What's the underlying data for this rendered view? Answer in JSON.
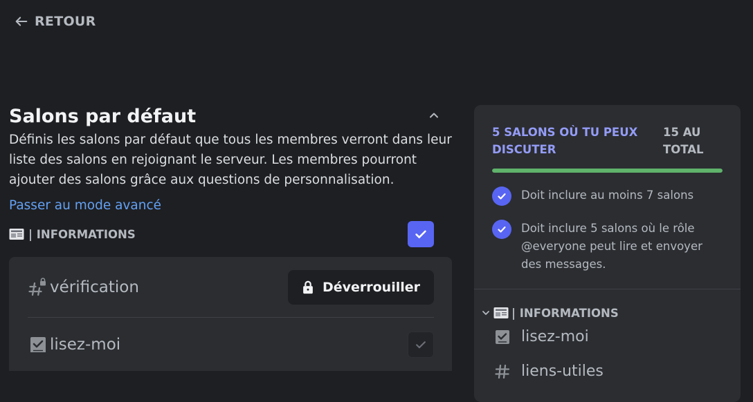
{
  "nav": {
    "back_label": "RETOUR"
  },
  "section": {
    "title": "Salons par défaut",
    "description": "Définis les salons par défaut que tous les membres verront dans leur liste des salons en rejoignant le serveur. Les membres pourront ajouter des salons grâce aux questions de personnalisation.",
    "advanced_link": "Passer au mode avancé"
  },
  "category": {
    "name": "| INFORMATIONS",
    "emoji_icon": "newspaper-icon",
    "checked": true
  },
  "channels": [
    {
      "name": "vérification",
      "icon": "locked-hash-icon",
      "action_label": "Déverrouiller"
    },
    {
      "name": "lisez-moi",
      "icon": "rules-icon",
      "checked": true
    }
  ],
  "summary": {
    "available": "5 SALONS OÙ TU PEUX DISCUTER",
    "total": "15 AU TOTAL",
    "progress": 1.0,
    "progress_color": "#5fb36b",
    "requirements": [
      "Doit inclure au moins 7 salons",
      "Doit inclure 5 salons où le rôle @everyone peut lire et envoyer des messages."
    ]
  },
  "preview": {
    "category": "| INFORMATIONS",
    "channels": [
      {
        "name": "lisez-moi",
        "icon": "rules-icon"
      },
      {
        "name": "liens-utiles",
        "icon": "hash-icon"
      }
    ]
  },
  "colors": {
    "accent": "#5865f2",
    "link": "#63a1f4",
    "background": "#1e1f22",
    "panel": "#2b2d31"
  }
}
